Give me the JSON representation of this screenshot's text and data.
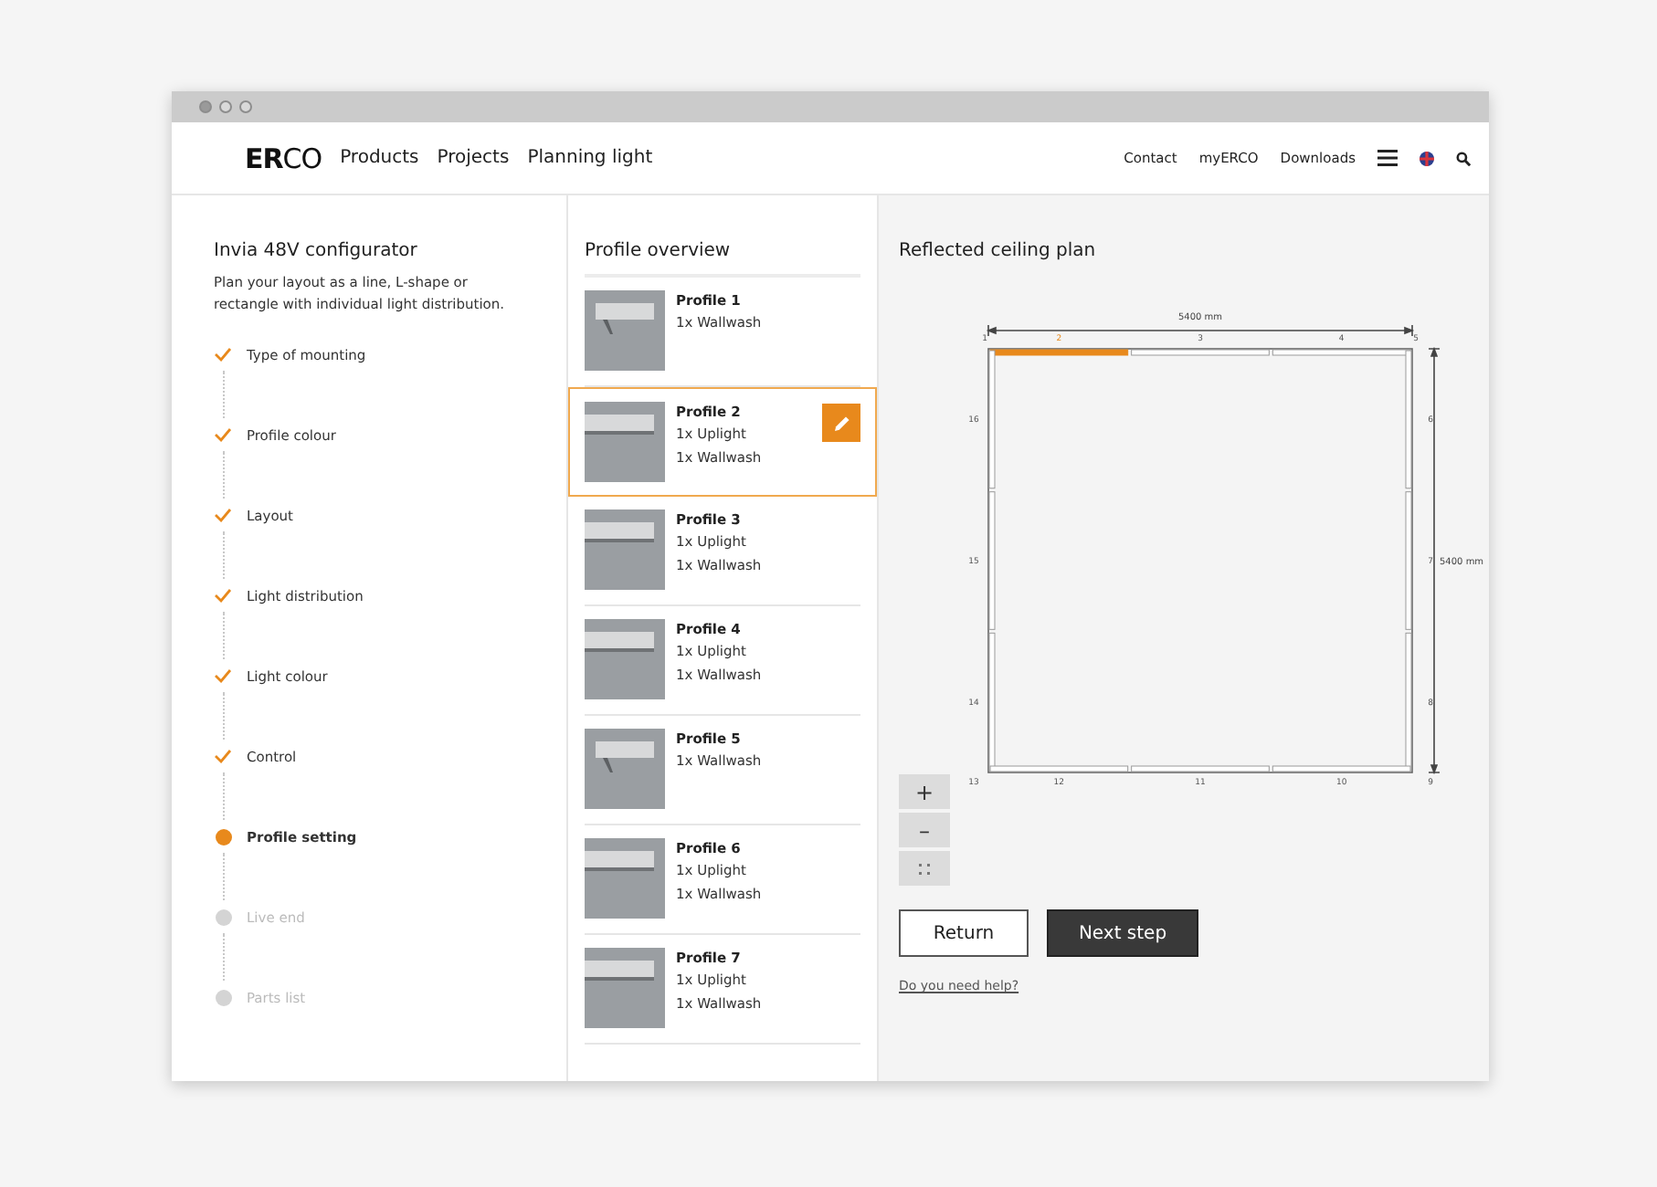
{
  "nav": {
    "logo": "**ER**CO",
    "links": [
      "Products",
      "Projects",
      "Planning light"
    ],
    "utility_links": [
      "Contact",
      "myERCO",
      "Downloads"
    ]
  },
  "configurator": {
    "title": "Invia 48V configurator",
    "description": "Plan your layout as a line, L-shape or rectangle with individual light distribution.",
    "steps": [
      {
        "label": "Type of mounting",
        "completed": true,
        "selected": false
      },
      {
        "label": "Profile colour",
        "completed": true,
        "selected": false
      },
      {
        "label": "Layout",
        "completed": true,
        "selected": false
      },
      {
        "label": "Light distribution",
        "completed": true,
        "selected": false
      },
      {
        "label": "Light colour",
        "completed": true,
        "selected": false
      },
      {
        "label": "Control",
        "completed": true,
        "selected": false
      },
      {
        "label": "Profile setting",
        "completed": false,
        "selected": true
      },
      {
        "label": "Live end",
        "completed": false,
        "selected": false
      },
      {
        "label": "Parts list",
        "completed": false,
        "selected": false
      }
    ]
  },
  "profile_overview": {
    "title": "Profile overview",
    "profiles": [
      {
        "name": "Profile 1",
        "lines": [
          "1x Wallwash"
        ],
        "selected": false
      },
      {
        "name": "Profile 2",
        "lines": [
          "1x Uplight",
          "1x Wallwash"
        ],
        "selected": true
      },
      {
        "name": "Profile 3",
        "lines": [
          "1x Uplight",
          "1x Wallwash"
        ],
        "selected": false
      },
      {
        "name": "Profile 4",
        "lines": [
          "1x Uplight",
          "1x Wallwash"
        ],
        "selected": false
      },
      {
        "name": "Profile 5",
        "lines": [
          "1x Wallwash"
        ],
        "selected": false
      },
      {
        "name": "Profile 6",
        "lines": [
          "1x Uplight",
          "1x Wallwash"
        ],
        "selected": false
      },
      {
        "name": "Profile 7",
        "lines": [
          "1x Uplight",
          "1x Wallwash"
        ],
        "selected": false
      }
    ]
  },
  "ceiling_plan": {
    "title": "Reflected ceiling plan",
    "width_label": "5400 mm",
    "height_label": "5400 mm",
    "edges": {
      "top": [
        {
          "label": "1",
          "kind": "corner"
        },
        {
          "label": "2",
          "kind": "segment",
          "selected": true
        },
        {
          "label": "3",
          "kind": "segment",
          "selected": false
        },
        {
          "label": "4",
          "kind": "segment",
          "selected": false
        },
        {
          "label": "5",
          "kind": "corner"
        }
      ],
      "left": [
        {
          "label": "16",
          "kind": "segment",
          "selected": false
        },
        {
          "label": "15",
          "kind": "segment",
          "selected": false
        },
        {
          "label": "14",
          "kind": "segment",
          "selected": false
        }
      ],
      "right": [
        {
          "label": "6",
          "kind": "segment",
          "selected": false
        },
        {
          "label": "7",
          "kind": "segment",
          "selected": false
        },
        {
          "label": "8",
          "kind": "segment",
          "selected": false
        }
      ],
      "bottom": [
        {
          "label": "13",
          "kind": "corner"
        },
        {
          "label": "12",
          "kind": "segment",
          "selected": false
        },
        {
          "label": "11",
          "kind": "segment",
          "selected": false
        },
        {
          "label": "10",
          "kind": "segment",
          "selected": false
        },
        {
          "label": "9",
          "kind": "corner"
        }
      ]
    },
    "zoom_controls": [
      "+",
      "–"
    ],
    "buttons": [
      {
        "label": "Return",
        "kind": "secondary"
      },
      {
        "label": "Next step",
        "kind": "primary"
      }
    ],
    "help_link": "Do you need help?"
  }
}
